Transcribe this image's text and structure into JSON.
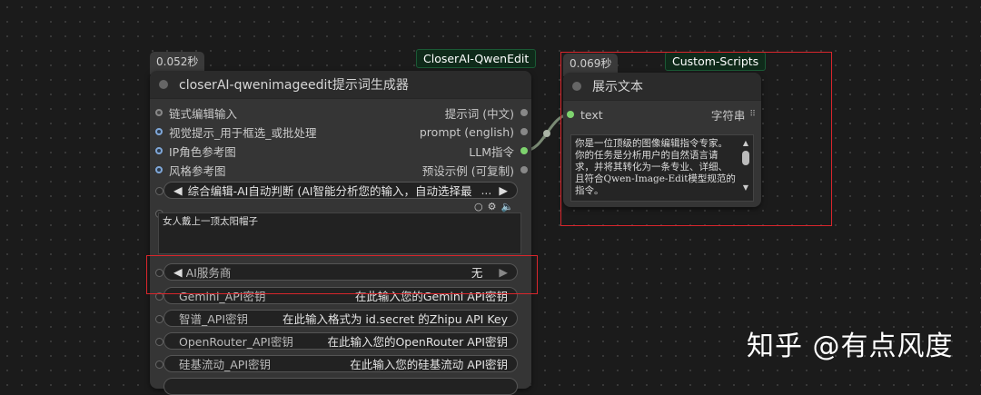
{
  "node1": {
    "timing": "0.052秒",
    "badge": "CloserAI-QwenEdit",
    "title": "closerAI-qwenimageedit提示词生成器",
    "inputs": [
      "链式编辑输入",
      "视觉提示_用于框选_或批处理",
      "IP角色参考图",
      "风格参考图"
    ],
    "outputs": [
      "提示词 (中文)",
      "prompt (english)",
      "LLM指令",
      "预设示例 (可复制)"
    ],
    "combo_mode": "综合编辑-AI自动判断 (AI智能分析您的输入，自动选择最",
    "combo_mode_more": "...",
    "textarea_text": "女人戴上一顶太阳帽子",
    "ai_service_label": "AI服务商",
    "ai_service_value": "无",
    "api_widgets": [
      {
        "label": "Gemini_API密钥",
        "value": "在此输入您的Gemini API密钥"
      },
      {
        "label": "智谱_API密钥",
        "value": "在此输入格式为 id.secret 的Zhipu API Key"
      },
      {
        "label": "OpenRouter_API密钥",
        "value": "在此输入您的OpenRouter API密钥"
      },
      {
        "label": "硅基流动_API密钥",
        "value": "在此输入您的硅基流动 API密钥"
      }
    ]
  },
  "node2": {
    "timing": "0.069秒",
    "badge": "Custom-Scripts",
    "title": "展示文本",
    "input": "text",
    "output": "字符串",
    "text": "你是一位顶级的图像编辑指令专家。你的任务是分析用户的自然语言请求，并将其转化为一条专业、详细、且符合Qwen-Image-Edit模型规范的指令。"
  },
  "watermark": "知乎 @有点风度",
  "colors": {
    "link": "#7fa7d8",
    "output_active": "#7ed36e",
    "highlight": "#d9262c"
  }
}
